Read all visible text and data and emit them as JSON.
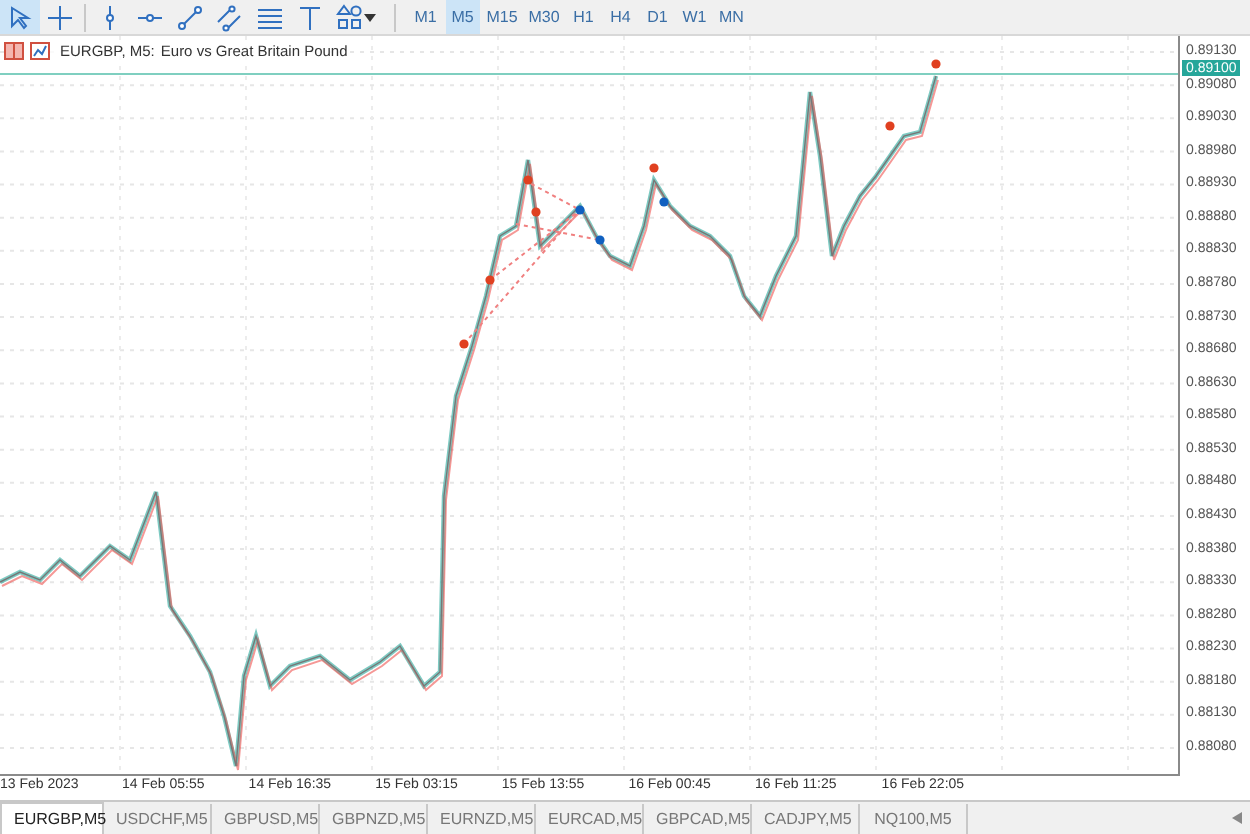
{
  "toolbar": {
    "tools": [
      {
        "kind": "cursor",
        "selected": true
      },
      {
        "kind": "crosshair",
        "selected": false
      },
      {
        "kind": "vline",
        "selected": false
      },
      {
        "kind": "hline",
        "selected": false
      },
      {
        "kind": "trend",
        "selected": false
      },
      {
        "kind": "channel",
        "selected": false
      },
      {
        "kind": "fibo",
        "selected": false
      },
      {
        "kind": "text",
        "selected": false
      },
      {
        "kind": "shapes",
        "selected": false
      }
    ],
    "timeframes": [
      {
        "label": "M1",
        "selected": false
      },
      {
        "label": "M5",
        "selected": true
      },
      {
        "label": "M15",
        "selected": false
      },
      {
        "label": "M30",
        "selected": false
      },
      {
        "label": "H1",
        "selected": false
      },
      {
        "label": "H4",
        "selected": false
      },
      {
        "label": "D1",
        "selected": false
      },
      {
        "label": "W1",
        "selected": false
      },
      {
        "label": "MN",
        "selected": false
      }
    ]
  },
  "chart": {
    "title": "EURGBP, M5:",
    "description": "Euro vs Great Britain Pound",
    "current_price": "0.89100",
    "price_labels": [
      "0.89130",
      "0.89080",
      "0.89030",
      "0.88980",
      "0.88930",
      "0.88880",
      "0.88830",
      "0.88780",
      "0.88730",
      "0.88680",
      "0.88630",
      "0.88580",
      "0.88530",
      "0.88480",
      "0.88430",
      "0.88380",
      "0.88330",
      "0.88280",
      "0.88230",
      "0.88180",
      "0.88130",
      "0.88080"
    ],
    "time_labels": [
      "13 Feb 2023",
      "14 Feb 05:55",
      "14 Feb 16:35",
      "15 Feb 03:15",
      "15 Feb 13:55",
      "16 Feb 00:45",
      "16 Feb 11:25",
      "16 Feb 22:05"
    ]
  },
  "tabs": [
    {
      "label": "EURGBP,M5",
      "selected": true
    },
    {
      "label": "USDCHF,M5",
      "selected": false
    },
    {
      "label": "GBPUSD,M5",
      "selected": false
    },
    {
      "label": "GBPNZD,M5",
      "selected": false
    },
    {
      "label": "EURNZD,M5",
      "selected": false
    },
    {
      "label": "EURCAD,M5",
      "selected": false
    },
    {
      "label": "GBPCAD,M5",
      "selected": false
    },
    {
      "label": "CADJPY,M5",
      "selected": false
    },
    {
      "label": "NQ100,M5",
      "selected": false
    }
  ]
}
